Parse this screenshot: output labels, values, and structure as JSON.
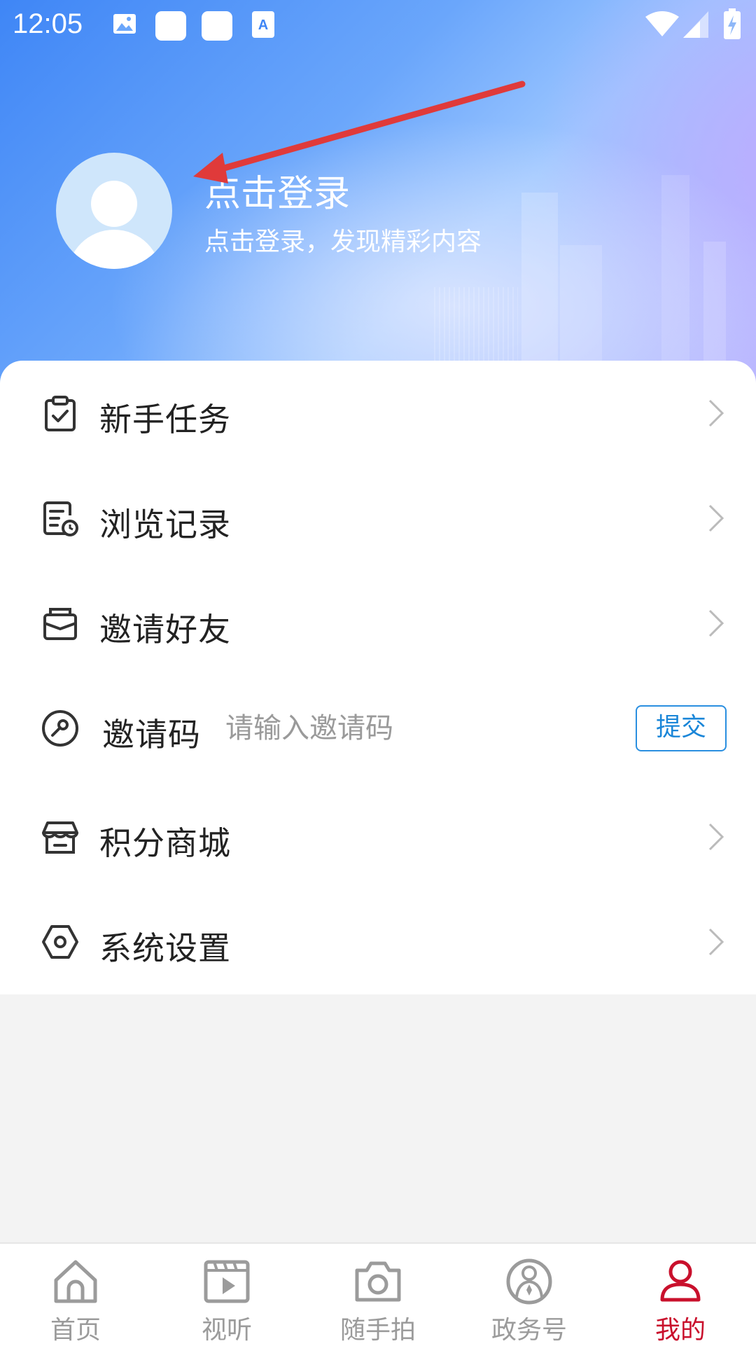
{
  "status_bar": {
    "time": "12:05",
    "icons": [
      "image-notification-icon",
      "app-notification-icon",
      "app-notification-icon",
      "text-notification-icon",
      "wifi-icon",
      "signal-icon",
      "battery-charging-icon"
    ]
  },
  "profile": {
    "title": "点击登录",
    "subtitle": "点击登录，发现精彩内容",
    "avatar_icon": "default-avatar-icon"
  },
  "annotation": {
    "arrow_color": "#e03a3a"
  },
  "menu": {
    "items": [
      {
        "label": "新手任务",
        "icon": "clipboard-check-icon"
      },
      {
        "label": "浏览记录",
        "icon": "history-document-icon"
      },
      {
        "label": "邀请好友",
        "icon": "envelope-icon"
      },
      {
        "label": "积分商城",
        "icon": "store-icon"
      },
      {
        "label": "系统设置",
        "icon": "hexagon-settings-icon"
      }
    ],
    "invite": {
      "label": "邀请码",
      "placeholder": "请输入邀请码",
      "value": "",
      "submit_label": "提交",
      "icon": "key-circle-icon"
    }
  },
  "bottom_nav": {
    "items": [
      {
        "label": "首页",
        "icon": "home-icon",
        "active": false
      },
      {
        "label": "视听",
        "icon": "video-play-icon",
        "active": false
      },
      {
        "label": "随手拍",
        "icon": "camera-icon",
        "active": false
      },
      {
        "label": "政务号",
        "icon": "government-person-icon",
        "active": false
      },
      {
        "label": "我的",
        "icon": "profile-icon",
        "active": true
      }
    ],
    "active_color": "#c9102c",
    "inactive_color": "#9b9b9b"
  },
  "colors": {
    "header_gradient_start": "#3f86f6",
    "header_gradient_end": "#b9b6ff",
    "accent_blue": "#1a86d8",
    "page_background": "#f3f3f3"
  }
}
